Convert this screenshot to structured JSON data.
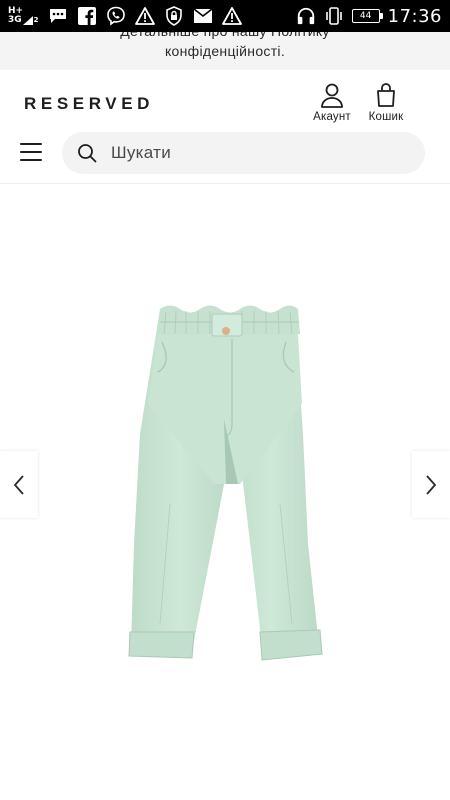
{
  "status_bar": {
    "network": "H+",
    "network_sub": "3G",
    "sim": "2",
    "battery": "44",
    "time": "17:36",
    "icons": [
      "message-icon",
      "facebook-icon",
      "viber-icon",
      "warning-icon",
      "lock-icon",
      "mail-icon",
      "warning-icon",
      "headset-icon",
      "vibrate-icon",
      "battery-icon"
    ]
  },
  "cookie_notice": {
    "line1": "Детальніше про нашу Політику",
    "line2": "конфіденційності."
  },
  "header": {
    "logo": "RESERVED",
    "account_label": "Акаунт",
    "cart_label": "Кошик",
    "menu_icon": "hamburger-icon"
  },
  "search": {
    "placeholder": "Шукати",
    "icon": "search-icon"
  },
  "product": {
    "image_name": "mint-paperbag-pants",
    "main_color": "#c9e3d3",
    "prev_icon": "chevron-left-icon",
    "next_icon": "chevron-right-icon"
  }
}
